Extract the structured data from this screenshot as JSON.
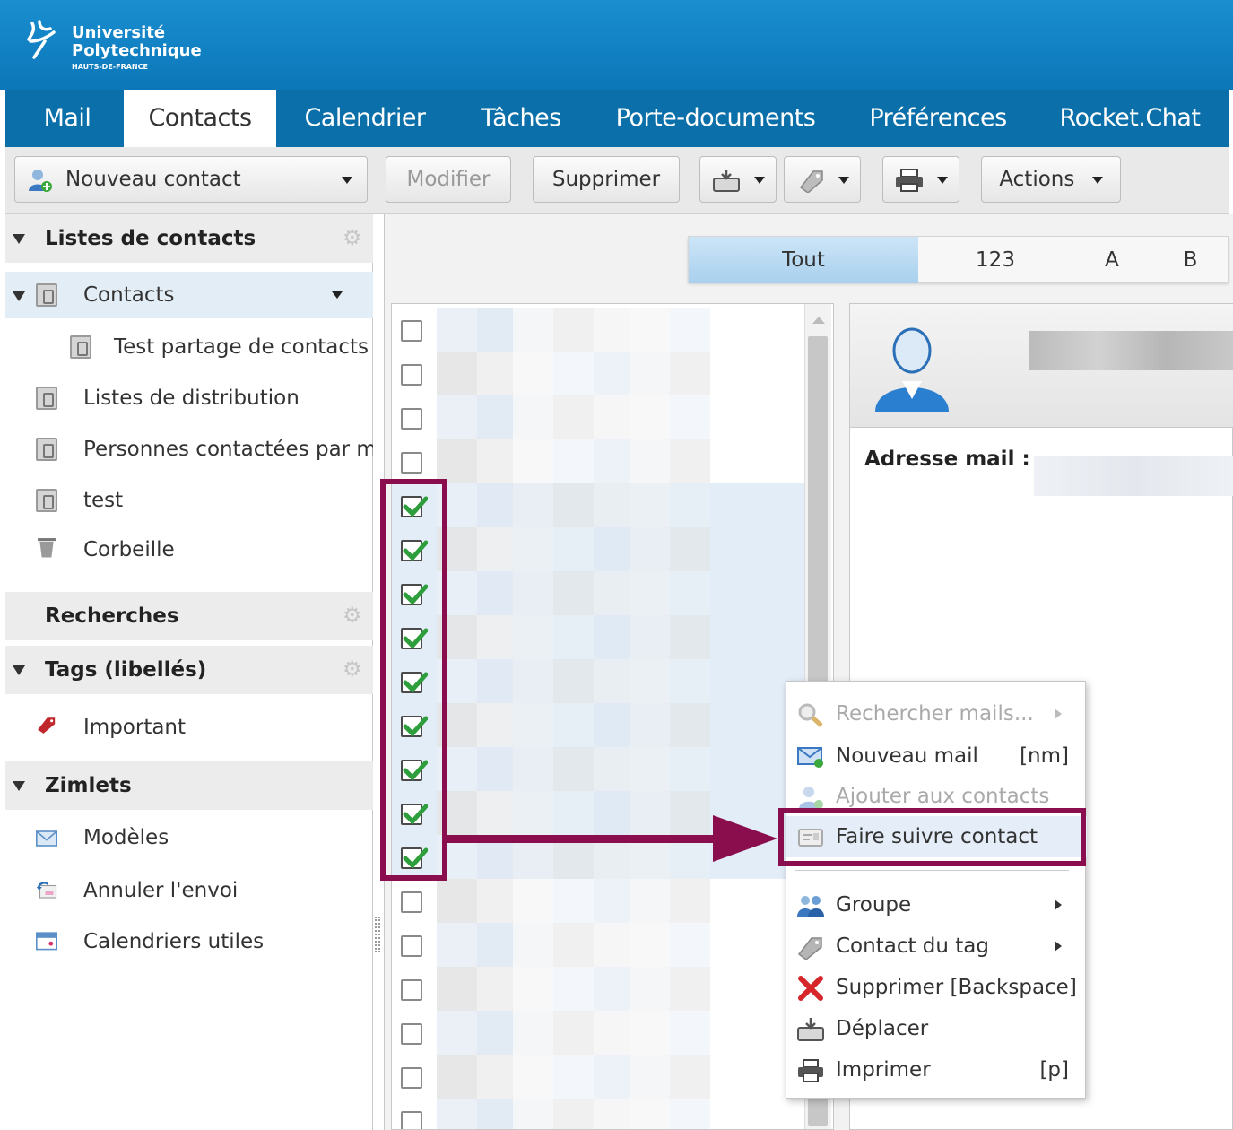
{
  "header": {
    "logo_line1": "Université",
    "logo_line2": "Polytechnique",
    "logo_line3": "HAUTS-DE-FRANCE",
    "brand_color": "#0b76b8"
  },
  "tabs": [
    "Mail",
    "Contacts",
    "Calendrier",
    "Tâches",
    "Porte-documents",
    "Préférences",
    "Rocket.Chat"
  ],
  "active_tab": "Contacts",
  "toolbar": {
    "new_contact": "Nouveau contact",
    "edit": "Modifier",
    "delete": "Supprimer",
    "actions": "Actions"
  },
  "sidebar": {
    "lists_header": "Listes de contacts",
    "items": [
      {
        "label": "Contacts",
        "icon": "address-book-icon"
      },
      {
        "label": "Test partage de contacts",
        "icon": "address-book-icon"
      },
      {
        "label": "Listes de distribution",
        "icon": "address-book-icon"
      },
      {
        "label": "Personnes contactées par m",
        "icon": "emailed-contacts-icon"
      },
      {
        "label": "test",
        "icon": "address-book-icon"
      },
      {
        "label": "Corbeille",
        "icon": "trash-icon"
      }
    ],
    "searches_header": "Recherches",
    "tags_header": "Tags (libellés)",
    "tags": [
      {
        "label": "Important",
        "icon": "tag-icon"
      }
    ],
    "zimlets_header": "Zimlets",
    "zimlets": [
      {
        "label": "Modèles",
        "icon": "envelope-icon"
      },
      {
        "label": "Annuler l'envoi",
        "icon": "undo-send-icon"
      },
      {
        "label": "Calendriers utiles",
        "icon": "calendar-icon"
      }
    ]
  },
  "alpha_filter": [
    "Tout",
    "123",
    "A",
    "B"
  ],
  "alpha_selected": "Tout",
  "contact_list": {
    "checked": [
      false,
      false,
      false,
      false,
      true,
      true,
      true,
      true,
      true,
      true,
      true,
      true,
      true,
      false,
      false,
      false,
      false,
      false,
      false
    ]
  },
  "contact_card": {
    "email_label": "Adresse mail :"
  },
  "context_menu": {
    "items": [
      {
        "label": "Rechercher mails...",
        "shortcut": "",
        "disabled": true,
        "submenu": true,
        "icon": "search-icon"
      },
      {
        "label": "Nouveau mail",
        "shortcut": "[nm]",
        "disabled": false,
        "submenu": false,
        "icon": "new-mail-icon"
      },
      {
        "label": "Ajouter aux contacts",
        "shortcut": "",
        "disabled": true,
        "submenu": false,
        "icon": "add-contact-icon"
      },
      {
        "label": "Faire suivre contact",
        "shortcut": "",
        "disabled": false,
        "submenu": false,
        "icon": "forward-contact-icon"
      },
      {
        "label": "Groupe",
        "shortcut": "",
        "disabled": false,
        "submenu": true,
        "icon": "group-icon"
      },
      {
        "label": "Contact du tag",
        "shortcut": "",
        "disabled": false,
        "submenu": true,
        "icon": "tag-icon"
      },
      {
        "label": "Supprimer [Backspace]",
        "shortcut": "",
        "disabled": false,
        "submenu": false,
        "icon": "delete-x-icon"
      },
      {
        "label": "Déplacer",
        "shortcut": "",
        "disabled": false,
        "submenu": false,
        "icon": "move-icon"
      },
      {
        "label": "Imprimer",
        "shortcut": "[p]",
        "disabled": false,
        "submenu": false,
        "icon": "print-icon"
      }
    ]
  },
  "annotation_color": "#8a0d4e"
}
